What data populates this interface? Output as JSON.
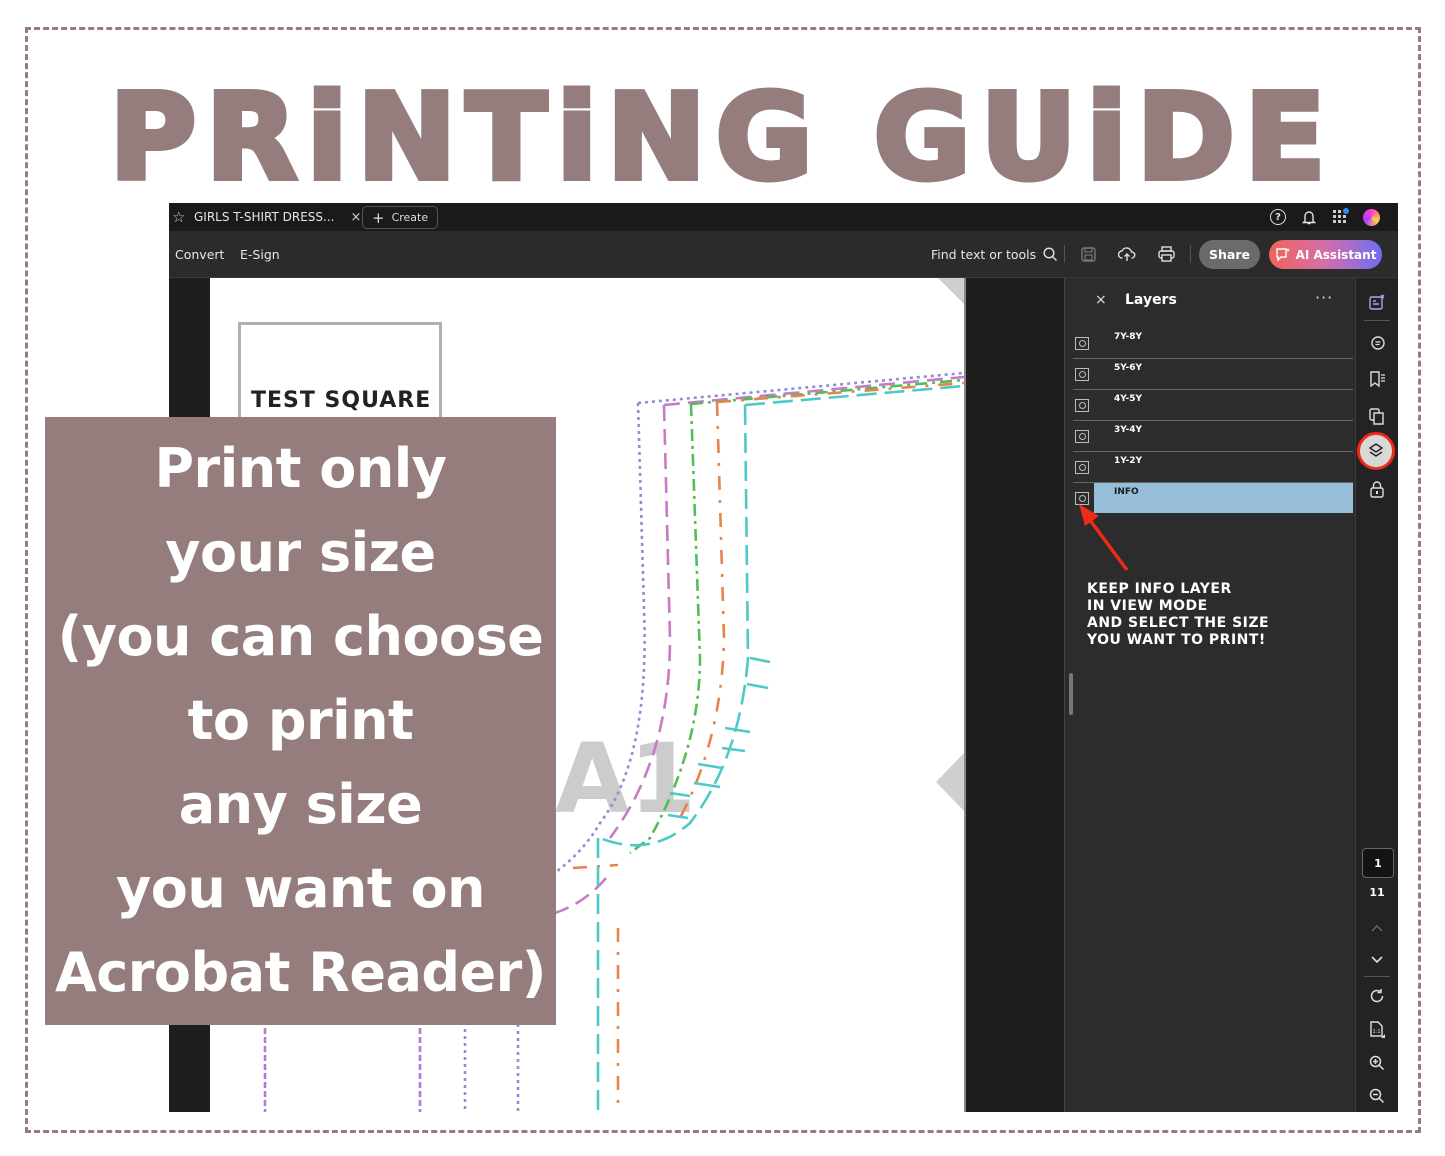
{
  "guide": {
    "title": "PRiNTiNG GUiDE",
    "overlay_lines": [
      "Print only",
      "your size",
      "(you can choose",
      "to print",
      "any size",
      "you want on",
      "Acrobat Reader)"
    ],
    "annotation_lines": [
      "KEEP INFO LAYER",
      "IN VIEW MODE",
      "AND SELECT THE SIZE",
      "YOU WANT TO PRINT!"
    ],
    "accent_color": "#957d7d",
    "highlight_color": "#ee2a1a"
  },
  "app": {
    "tab": {
      "title": "GIRLS T-SHIRT DRESS...",
      "close": "×",
      "star_icon": "☆"
    },
    "create_button": {
      "icon": "+",
      "label": "Create"
    },
    "top_icons": [
      "help-icon",
      "bell-icon",
      "apps-icon",
      "avatar"
    ],
    "toolbar": {
      "convert": "Convert",
      "esign": "E-Sign",
      "find": "Find text or tools",
      "share": "Share",
      "ai_assistant": "AI Assistant"
    },
    "document": {
      "test_square_label": "TEST SQUARE",
      "piece_label": "A1"
    },
    "layers_panel": {
      "close": "×",
      "title": "Layers",
      "more": "···",
      "layers": [
        {
          "name": "7Y-8Y",
          "selected": false
        },
        {
          "name": "5Y-6Y",
          "selected": false
        },
        {
          "name": "4Y-5Y",
          "selected": false
        },
        {
          "name": "3Y-4Y",
          "selected": false
        },
        {
          "name": "1Y-2Y",
          "selected": false
        },
        {
          "name": "INFO",
          "selected": true
        }
      ],
      "selected_color": "#96bed9"
    },
    "right_rail": {
      "current_page": "1",
      "total_pages": "11"
    }
  }
}
